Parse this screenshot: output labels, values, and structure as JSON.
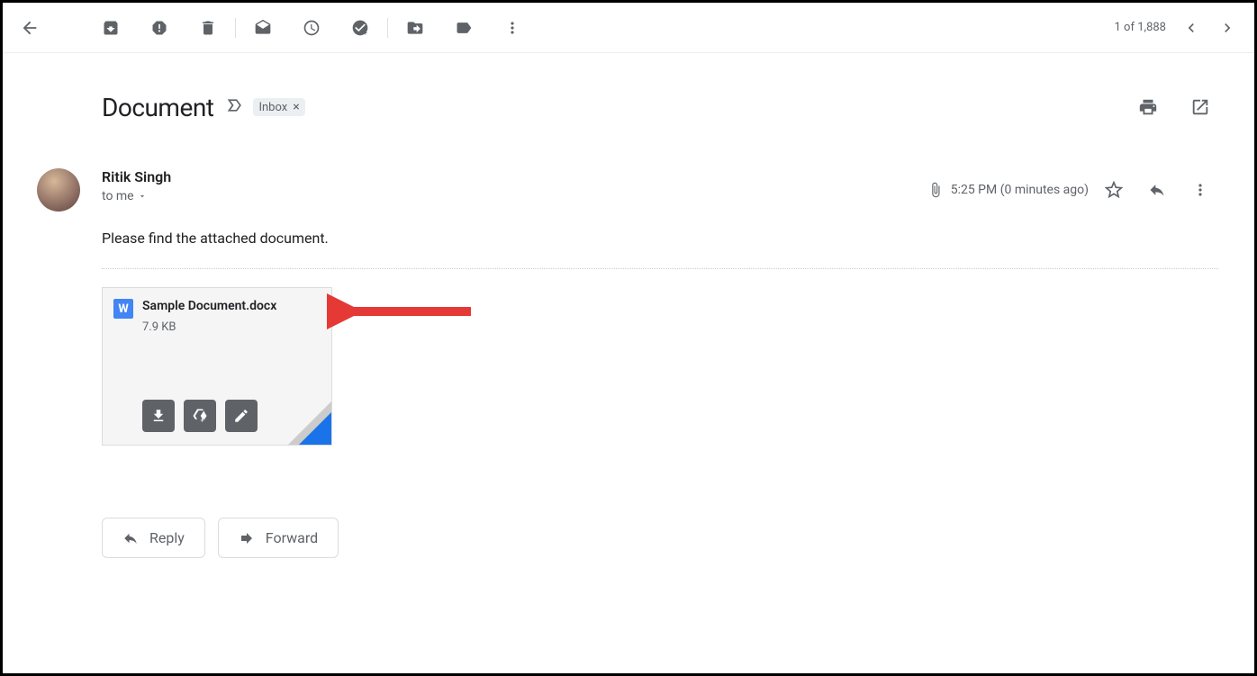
{
  "toolbar": {
    "pagination": "1 of 1,888"
  },
  "subject": "Document",
  "label": "Inbox",
  "sender": {
    "name": "Ritik Singh",
    "recipients": "to me"
  },
  "meta": {
    "time": "5:25 PM (0 minutes ago)"
  },
  "body": "Please find the attached document.",
  "attachment": {
    "icon_letter": "W",
    "name": "Sample Document.docx",
    "size": "7.9 KB"
  },
  "actions": {
    "reply": "Reply",
    "forward": "Forward"
  }
}
